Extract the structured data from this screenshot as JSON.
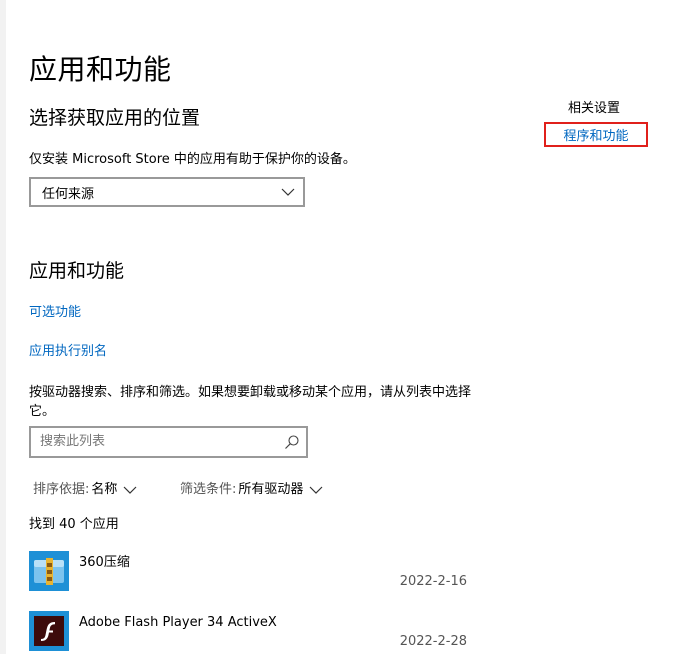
{
  "page": {
    "title": "应用和功能"
  },
  "install_location": {
    "heading": "选择获取应用的位置",
    "description": "仅安装 Microsoft Store 中的应用有助于保护你的设备。",
    "dropdown_value": "任何来源"
  },
  "related_settings": {
    "heading": "相关设置",
    "link": "程序和功能",
    "highlight_color": "#e0201b"
  },
  "apps_features": {
    "heading": "应用和功能",
    "optional_features_link": "可选功能",
    "app_alias_link": "应用执行别名",
    "description": "按驱动器搜索、排序和筛选。如果想要卸载或移动某个应用，请从列表中选择它。",
    "search_placeholder": "搜索此列表",
    "sort_label": "排序依据:",
    "sort_value": "名称",
    "filter_label": "筛选条件:",
    "filter_value": "所有驱动器",
    "count_text": "找到 40 个应用"
  },
  "apps": [
    {
      "name": "360压缩",
      "date": "2022-2-16",
      "icon": "360zip-icon"
    },
    {
      "name": "Adobe Flash Player 34 ActiveX",
      "date": "2022-2-28",
      "icon": "flash-icon"
    }
  ],
  "colors": {
    "link": "#0067c0",
    "text": "#000000",
    "secondary_text": "#555555",
    "border": "#999999"
  }
}
